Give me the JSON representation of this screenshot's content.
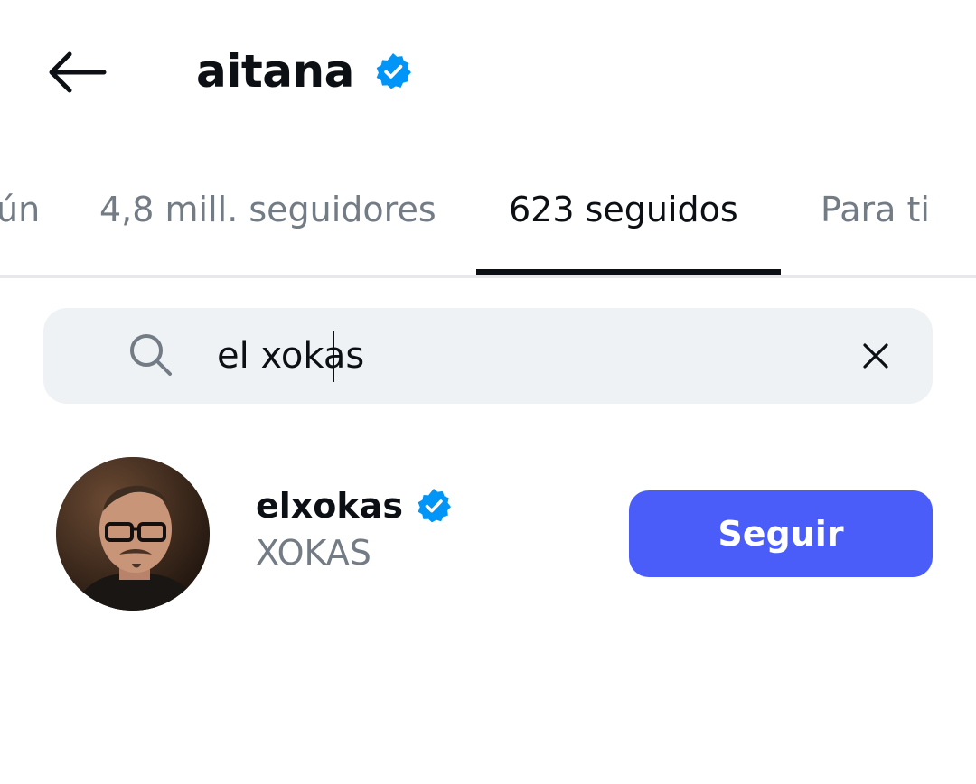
{
  "header": {
    "title": "aitana",
    "verified": true,
    "back_icon": "arrow-left-icon"
  },
  "tabs": [
    {
      "label": "ún",
      "active": false
    },
    {
      "label": "4,8 mill. seguidores",
      "active": false
    },
    {
      "label": "623 seguidos",
      "active": true
    },
    {
      "label": "Para ti",
      "active": false
    }
  ],
  "search": {
    "value": "el xokas",
    "icon": "search-icon",
    "clear_icon": "close-icon"
  },
  "results": [
    {
      "username": "elxokas",
      "full_name": "XOKAS",
      "verified": true,
      "button_label": "Seguir"
    }
  ],
  "colors": {
    "verified_blue": "#0095f6",
    "follow_button": "#4a5df9",
    "text_primary": "#0c1014",
    "text_secondary": "#737b85",
    "search_bg": "#eff2f5"
  }
}
